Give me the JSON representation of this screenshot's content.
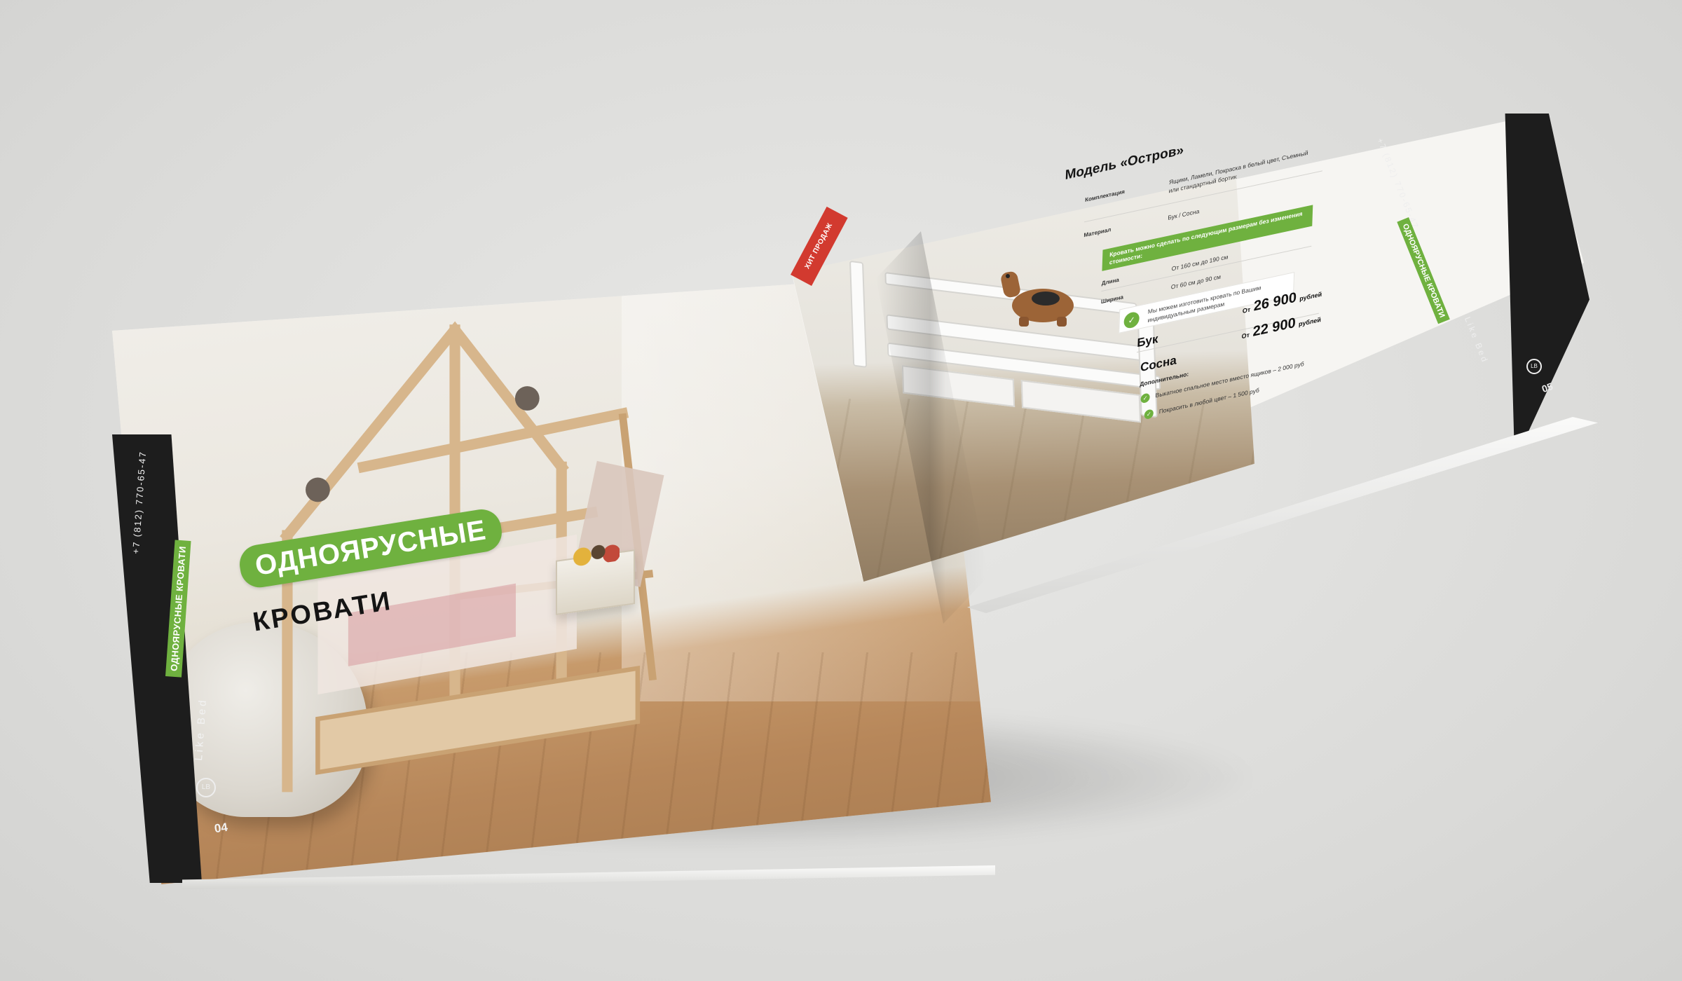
{
  "left_page": {
    "phone": "+7 (812) 770-65-47",
    "section_badge": "ОДНОЯРУСНЫЕ КРОВАТИ",
    "brand": "Like Bed",
    "logo_mark": "LB",
    "page_number": "04",
    "title_line1": "ОДНОЯРУСНЫЕ",
    "title_line2": "КРОВАТИ"
  },
  "right_page": {
    "ribbon": "ХИТ ПРОДАЖ",
    "phone": "+7 (812) 770-65-47",
    "section_badge": "ОДНОЯРУСНЫЕ КРОВАТИ",
    "brand": "Like Bed",
    "logo_mark": "LB",
    "page_number": "05",
    "model_title": "Модель «Остров»",
    "specs": [
      {
        "key": "Комплектация",
        "value": "Ящики, Ламели, Покраска в белый цвет, Съемный или стандартный бортик"
      },
      {
        "key": "Материал",
        "value": "Бук / Сосна"
      }
    ],
    "size_notice": "Кровать можно сделать по следующим размерам без изменения стоимости:",
    "dimensions": [
      {
        "key": "Длина",
        "value": "От 160 см до 190 см"
      },
      {
        "key": "Ширина",
        "value": "От 60 см до 90 см"
      }
    ],
    "custom_size_note": "Мы можем изготовить кровать по Вашим индивидуальным размерам",
    "prices": [
      {
        "wood": "Бук",
        "from": "От",
        "amount": "26 900",
        "currency": "рублей"
      },
      {
        "wood": "Сосна",
        "from": "От",
        "amount": "22 900",
        "currency": "рублей"
      }
    ],
    "extras_title": "Дополнительно:",
    "extras": [
      "Выкатное спальное место вместо ящиков – 2 000 руб",
      "Покрасить в любой цвет – 1 500 руб"
    ]
  },
  "colors": {
    "accent_green": "#6fb13f",
    "strip_black": "#1d1d1d",
    "ribbon_red": "#d23a2f"
  }
}
